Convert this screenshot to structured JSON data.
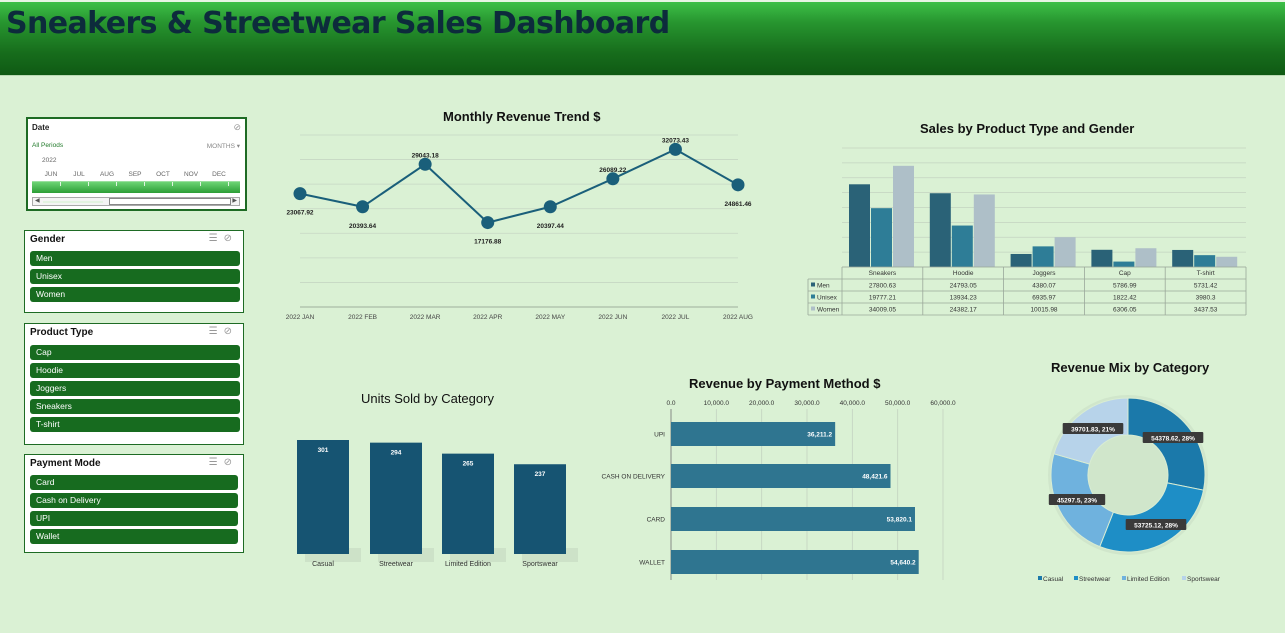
{
  "header": {
    "title": "Sneakers & Streetwear Sales Dashboard"
  },
  "timeline": {
    "title": "Date",
    "all_periods": "All Periods",
    "months_label": "MONTHS",
    "year": "2022",
    "months": [
      "JUN",
      "JUL",
      "AUG",
      "SEP",
      "OCT",
      "NOV",
      "DEC"
    ]
  },
  "slicers": {
    "gender": {
      "title": "Gender",
      "items": [
        "Men",
        "Unisex",
        "Women"
      ]
    },
    "product_type": {
      "title": "Product Type",
      "items": [
        "Cap",
        "Hoodie",
        "Joggers",
        "Sneakers",
        "T-shirt"
      ]
    },
    "payment_mode": {
      "title": "Payment Mode",
      "items": [
        "Card",
        "Cash on Delivery",
        "UPI",
        "Wallet"
      ]
    }
  },
  "colors": {
    "accent": "#1a5f7a",
    "slicer_item": "#176b1f",
    "men": "#2a6277",
    "unisex": "#2e7d97",
    "women": "#aebfc8",
    "casual": "#1b79aa",
    "streetwear": "#1e8ec6",
    "limited": "#6fb2de",
    "sportswear": "#b7d3ea"
  },
  "chart_data": [
    {
      "id": "monthly_revenue",
      "type": "line",
      "title": "Monthly Revenue Trend $",
      "x": [
        "2022 JAN",
        "2022 FEB",
        "2022 MAR",
        "2022 APR",
        "2022 MAY",
        "2022 JUN",
        "2022 JUL",
        "2022 AUG"
      ],
      "values": [
        23067.92,
        20393.64,
        29043.18,
        17176.88,
        20397.44,
        26089.22,
        32073.43,
        24861.46
      ],
      "value_labels": [
        "23067.92",
        "20393.64",
        "29043.18",
        "17176.88",
        "20397.44",
        "26089.22",
        "32073.43",
        "24861.46"
      ],
      "ylim": [
        0,
        35000
      ],
      "grid": true
    },
    {
      "id": "product_gender",
      "type": "bar",
      "title": "Sales by Product Type and Gender",
      "categories": [
        "Sneakers",
        "Hoodie",
        "Joggers",
        "Cap",
        "T-shirt"
      ],
      "series": [
        {
          "name": "Men",
          "values": [
            27800.63,
            24793.05,
            4380.07,
            5786.99,
            5731.42
          ],
          "labels": [
            "27800.63",
            "24793.05",
            "4380.07",
            "5786.99",
            "5731.42"
          ]
        },
        {
          "name": "Unisex",
          "values": [
            19777.21,
            13934.23,
            6935.97,
            1822.42,
            3980.3
          ],
          "labels": [
            "19777.21",
            "13934.23",
            "6935.97",
            "1822.42",
            "3980.3"
          ]
        },
        {
          "name": "Women",
          "values": [
            34009.05,
            24382.17,
            10015.98,
            6306.05,
            3437.53
          ],
          "labels": [
            "34009.05",
            "24382.17",
            "10015.98",
            "6306.05",
            "3437.53"
          ]
        }
      ],
      "ylim": [
        0,
        40000
      ],
      "legend": "data-table"
    },
    {
      "id": "units_category",
      "type": "bar",
      "title": "Units Sold by Category",
      "categories": [
        "Casual",
        "Streetwear",
        "Limited Edition",
        "Sportswear"
      ],
      "values": [
        301,
        294,
        265,
        237
      ],
      "value_labels": [
        "301",
        "294",
        "265",
        "237"
      ]
    },
    {
      "id": "payment_revenue",
      "type": "bar",
      "orientation": "horizontal",
      "title": "Revenue by Payment Method $",
      "categories": [
        "UPI",
        "CASH ON DELIVERY",
        "CARD",
        "WALLET"
      ],
      "values": [
        36211.2,
        48421.6,
        53820.1,
        54640.2
      ],
      "value_labels": [
        "36,211.2",
        "48,421.6",
        "53,820.1",
        "54,640.2"
      ],
      "xlim": [
        0,
        60000
      ],
      "ticks": [
        0,
        10000,
        20000,
        30000,
        40000,
        50000,
        60000
      ],
      "tick_labels": [
        "0.0",
        "10,000.0",
        "20,000.0",
        "30,000.0",
        "40,000.0",
        "50,000.0",
        "60,000.0"
      ],
      "axis_position": "top"
    },
    {
      "id": "revenue_mix",
      "type": "pie",
      "donut": true,
      "title": "Revenue Mix by Category",
      "categories": [
        "Casual",
        "Streetwear",
        "Limited Edition",
        "Sportswear"
      ],
      "values": [
        54378.62,
        53725.12,
        45297.5,
        39701.83
      ],
      "value_labels": [
        "54378.62, 28%",
        "53725.12, 28%",
        "45297.5, 23%",
        "39701.83, 21%"
      ],
      "legend": "bottom"
    }
  ]
}
